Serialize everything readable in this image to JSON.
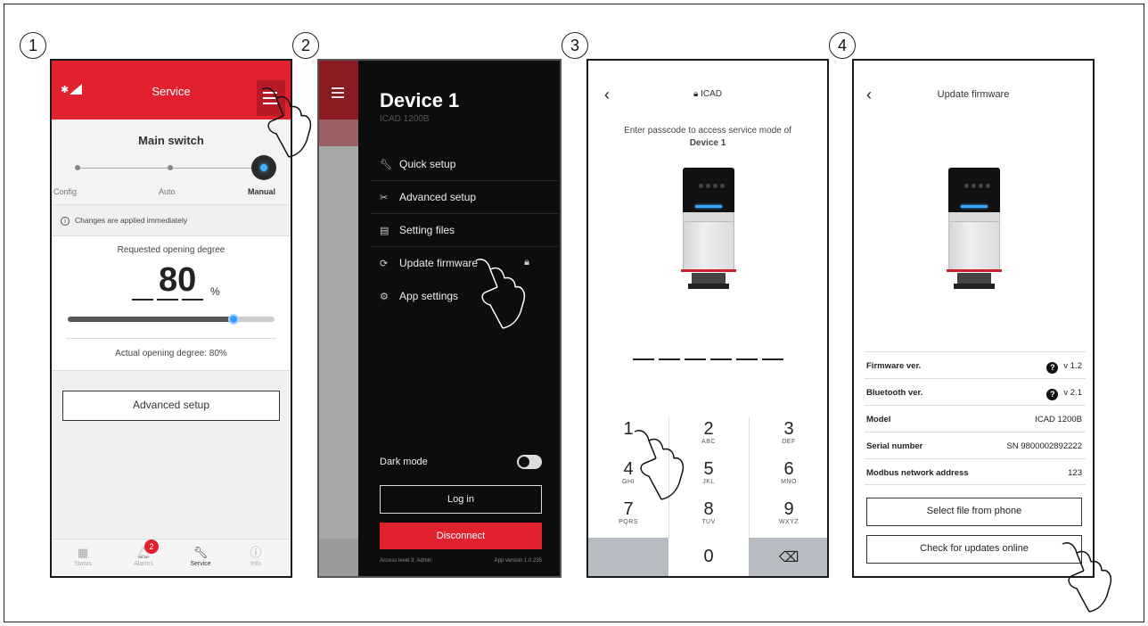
{
  "steps": [
    "1",
    "2",
    "3",
    "4"
  ],
  "phone1": {
    "header_title": "Service",
    "status_icons": {
      "bluetooth": "bluetooth-icon",
      "signal": "signal-icon"
    },
    "menu_icon": "hamburger-menu-icon",
    "main_switch_title": "Main switch",
    "switch_options": [
      "Config",
      "Auto",
      "Manual"
    ],
    "selected_option": "Manual",
    "info_note": "Changes are applied immediately",
    "requested_label": "Requested opening degree",
    "requested_value": "80",
    "requested_unit": "%",
    "slider_value_percent": 80,
    "actual_label": "Actual opening degree: 80%",
    "advanced_button": "Advanced setup",
    "tabs": [
      {
        "label": "Status",
        "icon": "grid-icon"
      },
      {
        "label": "Alarms",
        "icon": "bell-icon",
        "badge": "2"
      },
      {
        "label": "Service",
        "icon": "wrench-icon",
        "active": true
      },
      {
        "label": "Info",
        "icon": "info-icon"
      }
    ],
    "colors": {
      "brand_red": "#e2212f",
      "accent_blue": "#3a9bff"
    }
  },
  "phone2": {
    "device_title": "Device 1",
    "device_model": "ICAD 1200B",
    "menu_items": [
      {
        "label": "Quick setup",
        "icon": "wrench-icon"
      },
      {
        "label": "Advanced setup",
        "icon": "tools-icon"
      },
      {
        "label": "Setting files",
        "icon": "file-icon"
      },
      {
        "label": "Update firmware",
        "icon": "firmware-icon",
        "locked": true
      },
      {
        "label": "App settings",
        "icon": "gear-icon"
      }
    ],
    "dark_mode_label": "Dark mode",
    "dark_mode_on": true,
    "login_button": "Log in",
    "disconnect_button": "Disconnect",
    "access_level": "Access level 3: Admin",
    "app_version": "App version 1.0.235"
  },
  "phone3": {
    "header_title": "ICAD",
    "prompt_prefix": "Enter passcode to access service mode of ",
    "prompt_device": "Device 1",
    "keypad": [
      {
        "n": "1",
        "l": ""
      },
      {
        "n": "2",
        "l": "ABC"
      },
      {
        "n": "3",
        "l": "DEF"
      },
      {
        "n": "4",
        "l": "GHI"
      },
      {
        "n": "5",
        "l": "JKL"
      },
      {
        "n": "6",
        "l": "MNO"
      },
      {
        "n": "7",
        "l": "PQRS"
      },
      {
        "n": "8",
        "l": "TUV"
      },
      {
        "n": "9",
        "l": "WXYZ"
      },
      {
        "n": "",
        "l": ""
      },
      {
        "n": "0",
        "l": ""
      },
      {
        "n": "⌫",
        "l": ""
      }
    ]
  },
  "phone4": {
    "header_title": "Update firmware",
    "rows": [
      {
        "key": "Firmware ver.",
        "value": "v 1.2",
        "help": true
      },
      {
        "key": "Bluetooth ver.",
        "value": "v 2.1",
        "help": true
      },
      {
        "key": "Model",
        "value": "ICAD 1200B",
        "help": false
      },
      {
        "key": "Serial number",
        "value": "SN 9800002892222",
        "help": false
      },
      {
        "key": "Modbus network address",
        "value": "123",
        "help": false
      }
    ],
    "select_button": "Select file from phone",
    "check_button": "Check for updates online"
  }
}
